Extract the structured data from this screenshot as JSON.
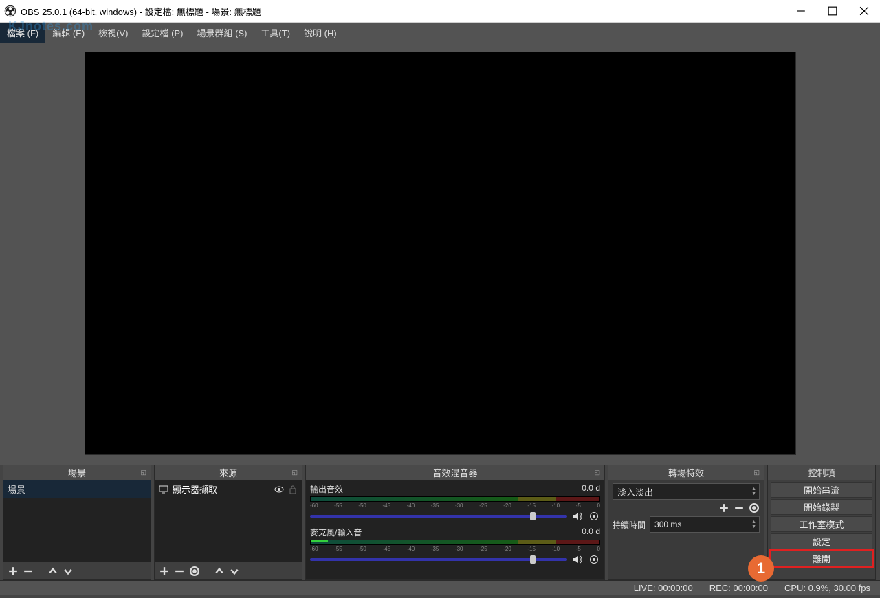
{
  "window": {
    "title": "OBS 25.0.1 (64-bit, windows) - 設定檔: 無標題 - 場景: 無標題",
    "watermark": "KJnotes.com"
  },
  "menu": {
    "file": "檔案 (F)",
    "edit": "編輯 (E)",
    "view": "檢視(V)",
    "profile": "設定檔 (P)",
    "scene_collection": "場景群組 (S)",
    "tools": "工具(T)",
    "help": "說明 (H)"
  },
  "panels": {
    "scenes": {
      "title": "場景",
      "items": [
        "場景"
      ]
    },
    "sources": {
      "title": "來源",
      "items": [
        {
          "label": "顯示器擷取"
        }
      ]
    },
    "mixer": {
      "title": "音效混音器",
      "items": [
        {
          "label": "輸出音效",
          "level": "0.0 d"
        },
        {
          "label": "麥克風/輸入音",
          "level": "0.0 d"
        }
      ],
      "ticks": [
        "-60",
        "-55",
        "-50",
        "-45",
        "-40",
        "-35",
        "-30",
        "-25",
        "-20",
        "-15",
        "-10",
        "-5",
        "0"
      ]
    },
    "transitions": {
      "title": "轉場特效",
      "selected": "淡入淡出",
      "duration_label": "持續時間",
      "duration_value": "300 ms"
    },
    "controls": {
      "title": "控制項",
      "buttons": {
        "start_stream": "開始串流",
        "start_record": "開始錄製",
        "studio_mode": "工作室模式",
        "settings": "設定",
        "exit": "離開"
      }
    }
  },
  "status": {
    "live": "LIVE: 00:00:00",
    "rec": "REC: 00:00:00",
    "cpu": "CPU: 0.9%, 30.00 fps"
  },
  "annotation": {
    "badge": "1"
  }
}
